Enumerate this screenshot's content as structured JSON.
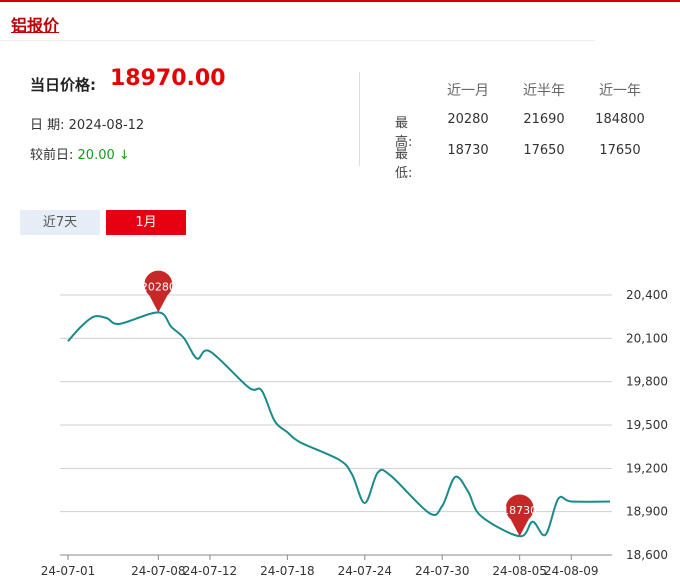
{
  "page": {
    "title": "铝报价"
  },
  "summary": {
    "current_label": "当日价格:",
    "current_value": "18970.00",
    "date_label": "日  期:",
    "date_value": "2024-08-12",
    "change_label": "较前日:",
    "change_value": "20.00",
    "change_arrow": "↓"
  },
  "stats": {
    "headers": [
      "近一月",
      "近半年",
      "近一年"
    ],
    "rows": [
      {
        "label": "最高:",
        "values": [
          "20280",
          "21690",
          "184800"
        ]
      },
      {
        "label": "最低:",
        "values": [
          "18730",
          "17650",
          "17650"
        ]
      }
    ]
  },
  "tabs": [
    {
      "label": "近7天",
      "active": false
    },
    {
      "label": "1月",
      "active": true
    }
  ],
  "colors": {
    "accent": "#e60012",
    "line": "#1a8a8a",
    "pin": "#c62828",
    "up_down_green": "#1a9a1a"
  },
  "chart_data": {
    "type": "line",
    "x_tick_labels": [
      "24-07-01",
      "24-07-08",
      "24-07-12",
      "24-07-18",
      "24-07-24",
      "24-07-30",
      "24-08-05",
      "24-08-09"
    ],
    "y_tick_labels": [
      "18,600",
      "18,900",
      "19,200",
      "19,500",
      "19,800",
      "20,100",
      "20,400"
    ],
    "ylim": [
      18600,
      20400
    ],
    "y_ticks": [
      18600,
      18900,
      19200,
      19500,
      19800,
      20100,
      20400
    ],
    "grid": true,
    "series": [
      {
        "x": [
          "2024-07-01",
          "2024-07-02",
          "2024-07-03",
          "2024-07-04",
          "2024-07-05",
          "2024-07-08",
          "2024-07-09",
          "2024-07-10",
          "2024-07-11",
          "2024-07-12",
          "2024-07-15",
          "2024-07-16",
          "2024-07-17",
          "2024-07-18",
          "2024-07-19",
          "2024-07-22",
          "2024-07-23",
          "2024-07-24",
          "2024-07-25",
          "2024-07-26",
          "2024-07-29",
          "2024-07-30",
          "2024-07-31",
          "2024-08-01",
          "2024-08-02",
          "2024-08-05",
          "2024-08-06",
          "2024-08-07",
          "2024-08-08",
          "2024-08-09",
          "2024-08-12"
        ],
        "values": [
          20080,
          20180,
          20250,
          20240,
          20200,
          20280,
          20180,
          20100,
          19960,
          20010,
          19760,
          19740,
          19530,
          19450,
          19380,
          19260,
          19160,
          18960,
          19170,
          19150,
          18890,
          18940,
          19140,
          19040,
          18870,
          18730,
          18830,
          18740,
          18990,
          18970,
          18970
        ]
      }
    ],
    "annotations": [
      {
        "label": "20280",
        "x": "2024-07-08",
        "value": 20280
      },
      {
        "label": "18730",
        "x": "2024-08-05",
        "value": 18730
      }
    ]
  }
}
